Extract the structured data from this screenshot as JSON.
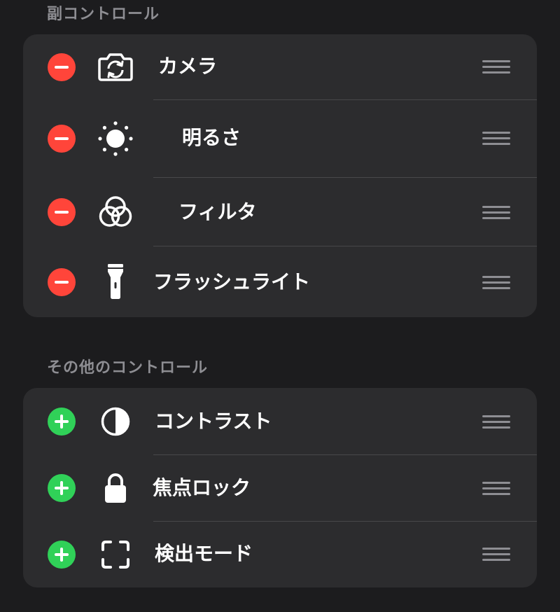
{
  "sections": [
    {
      "header": "副コントロール",
      "items": [
        {
          "label": "カメラ",
          "icon": "camera-switch-icon",
          "action": "remove"
        },
        {
          "label": "明るさ",
          "icon": "brightness-icon",
          "action": "remove"
        },
        {
          "label": "フィルタ",
          "icon": "filters-icon",
          "action": "remove"
        },
        {
          "label": "フラッシュライト",
          "icon": "flashlight-icon",
          "action": "remove"
        }
      ]
    },
    {
      "header": "その他のコントロール",
      "items": [
        {
          "label": "コントラスト",
          "icon": "contrast-icon",
          "action": "add"
        },
        {
          "label": "焦点ロック",
          "icon": "lock-icon",
          "action": "add"
        },
        {
          "label": "検出モード",
          "icon": "viewfinder-icon",
          "action": "add"
        }
      ]
    }
  ],
  "colors": {
    "background": "#1c1c1e",
    "group_background": "#2c2c2e",
    "remove": "#ff453a",
    "add": "#30d158",
    "header_text": "#8e8e93",
    "handle": "#8e8e93"
  }
}
